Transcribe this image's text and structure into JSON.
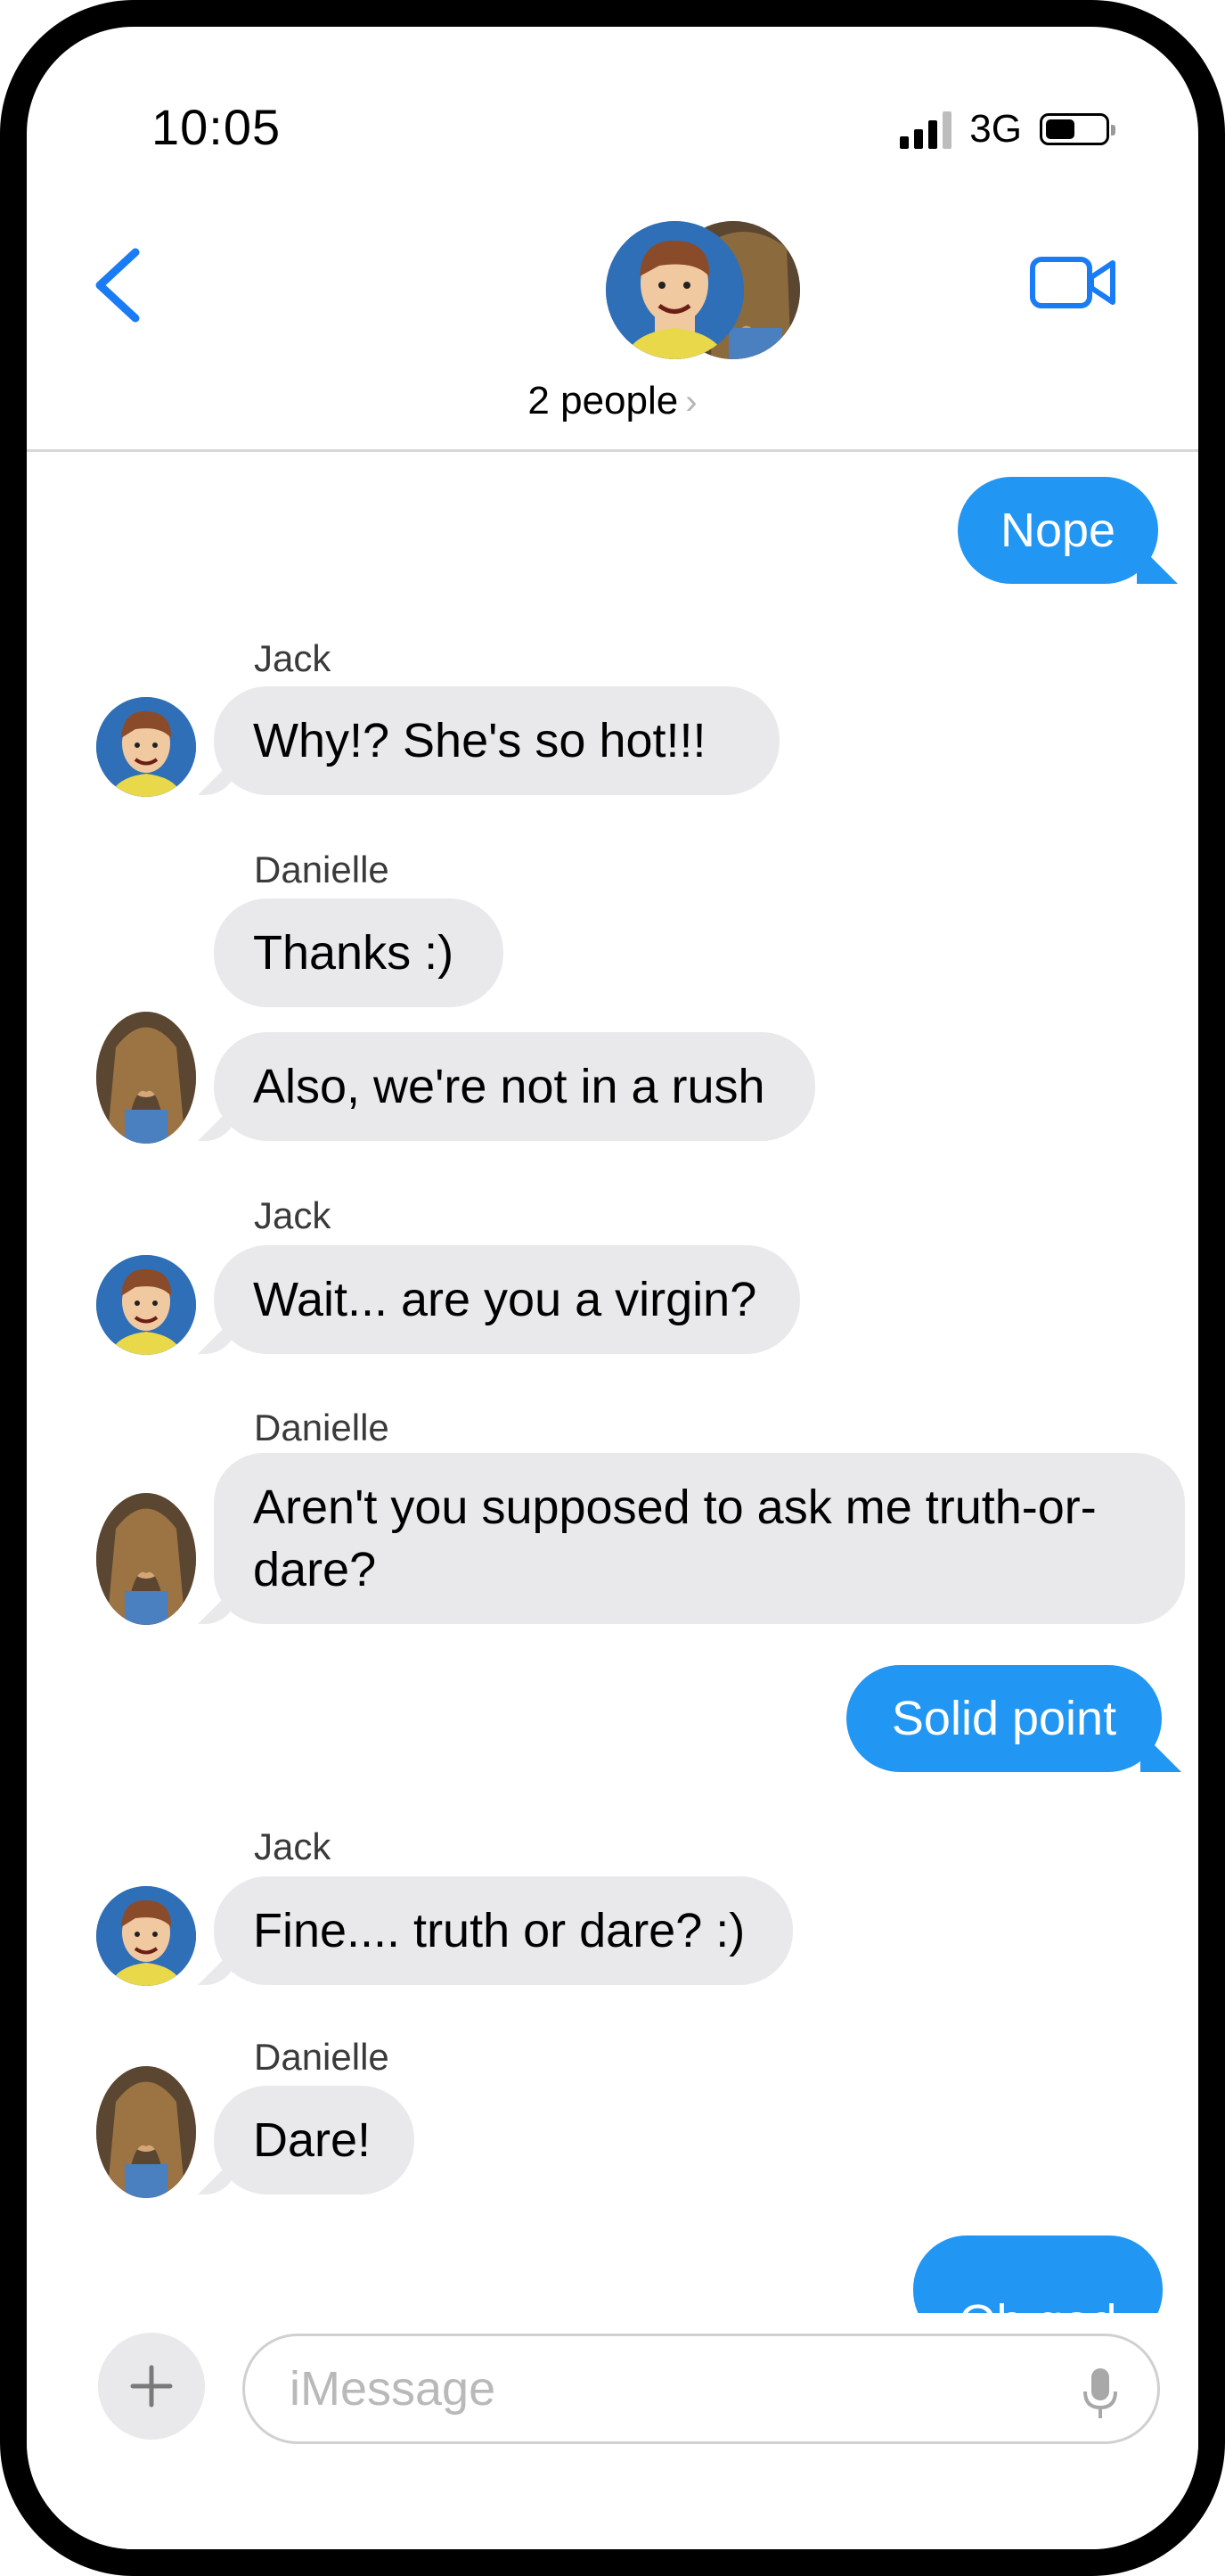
{
  "status_bar": {
    "time": "10:05",
    "network": "3G"
  },
  "header": {
    "people_label": "2 people",
    "chevron": "›"
  },
  "messages": [
    {
      "text": "Nope"
    },
    {
      "sender": "Jack",
      "text": "Why!?  She's so hot!!!"
    },
    {
      "sender": "Danielle",
      "text": "Thanks :)"
    },
    {
      "text": "Also, we're not in a rush"
    },
    {
      "sender": "Jack",
      "text": "Wait... are you a virgin?"
    },
    {
      "sender": "Danielle",
      "text_line1": "Aren't you supposed to ask me truth-or-",
      "text_line2": "dare?"
    },
    {
      "text": "Solid point"
    },
    {
      "sender": "Jack",
      "text": "Fine.... truth or dare? :)"
    },
    {
      "sender": "Danielle",
      "text": "Dare!"
    },
    {
      "text": "Oh god"
    }
  ],
  "composer": {
    "placeholder": "iMessage",
    "plus": "+"
  },
  "colors": {
    "accent": "#2196f3",
    "incoming_bubble": "#e9e9eb",
    "ios_blue": "#1a7cf5"
  },
  "icons": [
    "back-chevron-icon",
    "video-camera-icon",
    "plus-icon",
    "microphone-icon",
    "signal-icon",
    "battery-icon"
  ]
}
